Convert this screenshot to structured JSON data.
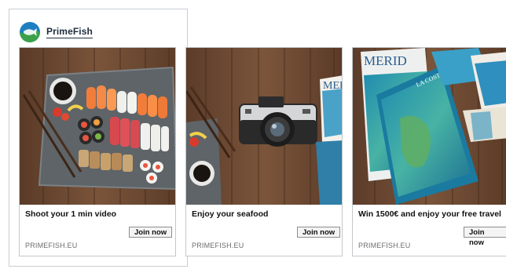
{
  "brand": {
    "name": "PrimeFish",
    "logo_icon": "fish-logo-icon"
  },
  "cards": [
    {
      "caption": "Shoot your 1 min video",
      "button": "Join now",
      "url": "PRIMEFISH.EU",
      "image": "sushi-platter-image"
    },
    {
      "caption": "Enjoy your seafood",
      "button": "Join now",
      "url": "PRIMEFISH.EU",
      "image": "camera-on-table-image"
    },
    {
      "caption": "Win 1500€ and enjoy your free travel",
      "button": "Join now",
      "url": "PRIMEFISH.EU",
      "image": "travel-brochures-image"
    }
  ],
  "brochure_text": {
    "title": "MERID",
    "subtitle": "LA COSTA D'ARGENTO"
  },
  "colors": {
    "wood": "#6b4a34",
    "accent_blue": "#1e7fc0",
    "accent_green": "#3aa14a"
  }
}
